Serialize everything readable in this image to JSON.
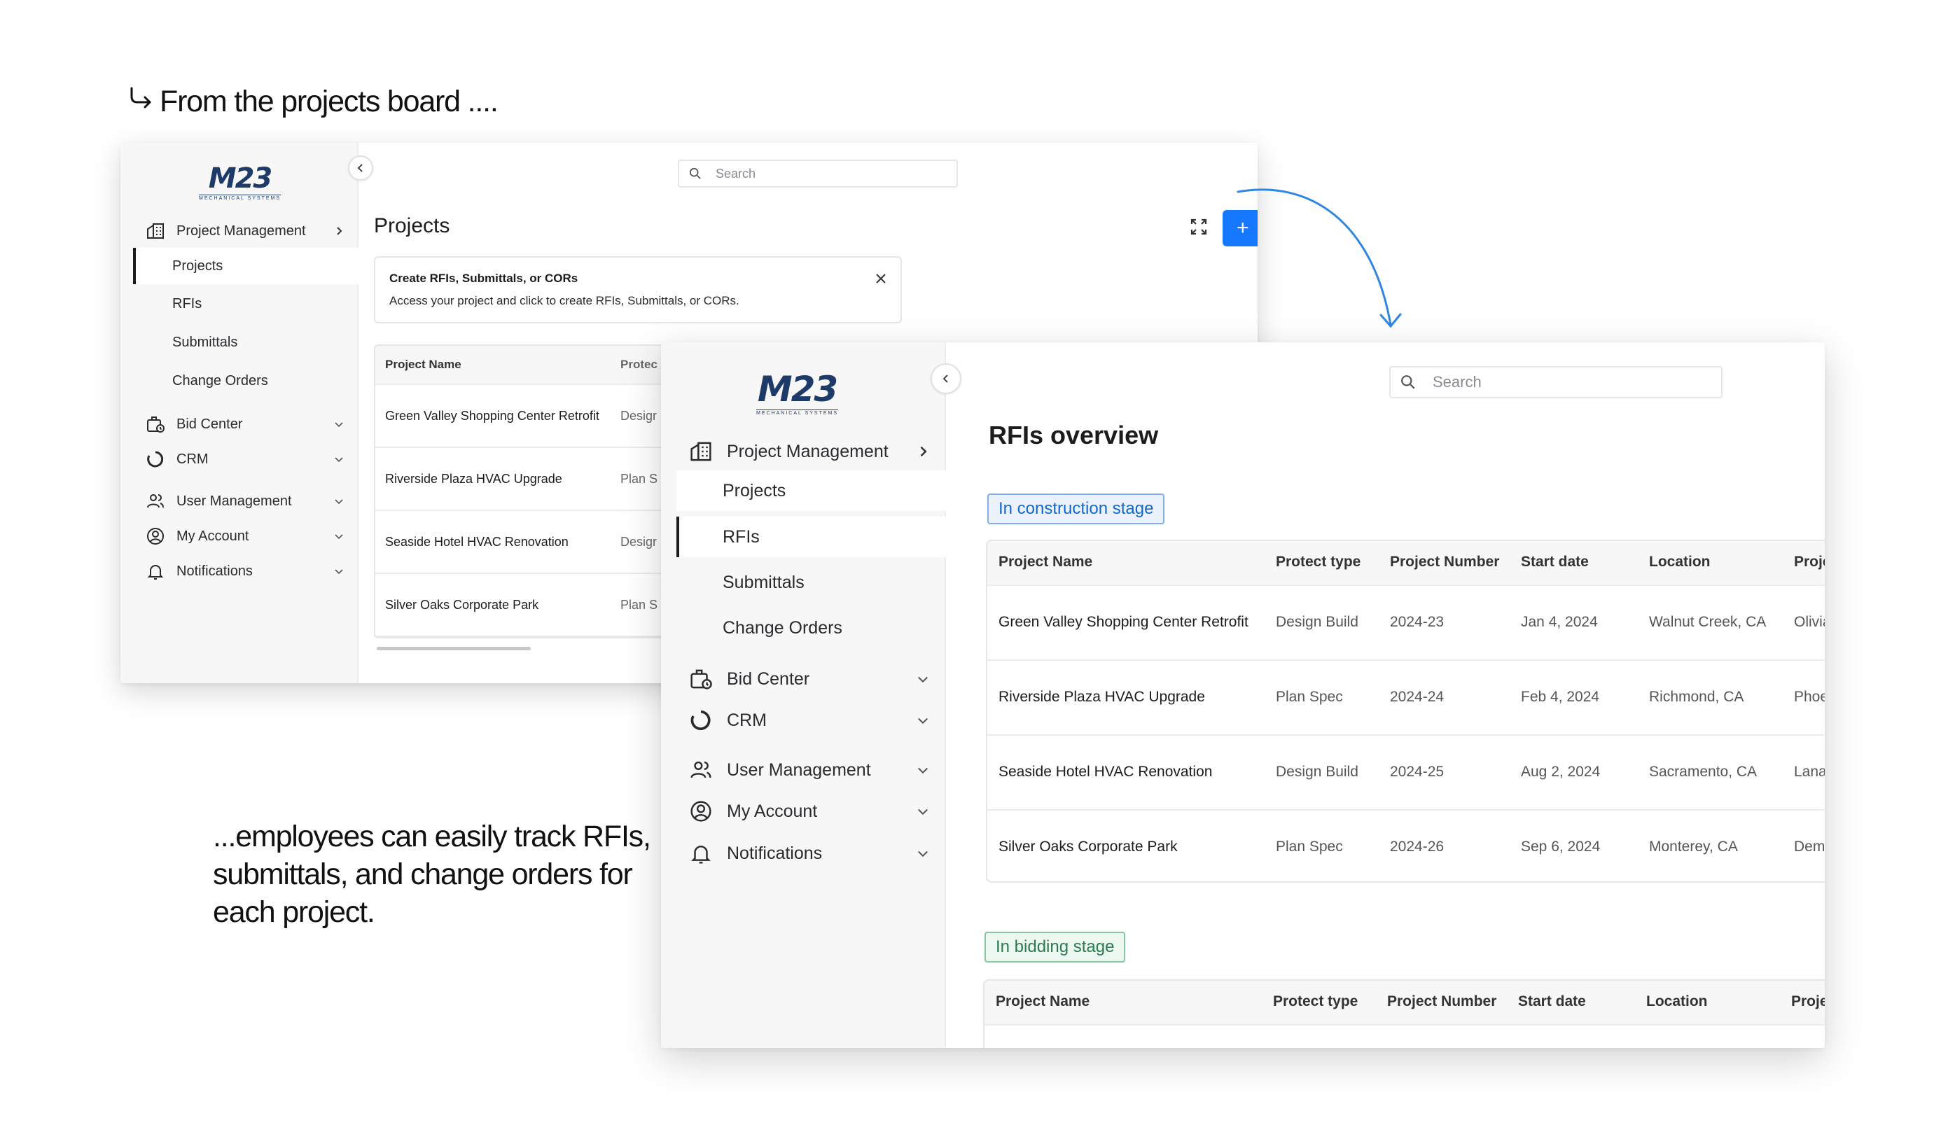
{
  "captions": {
    "top": "From the projects board ....",
    "bottom": "...employees can easily track RFIs, submittals, and change orders for each project."
  },
  "brand": {
    "logo_mark": "M23",
    "logo_sub": "MECHANICAL SYSTEMS",
    "accent": "#1677ff"
  },
  "sidebar": {
    "section": "Project Management",
    "items": [
      "Projects",
      "RFIs",
      "Submittals",
      "Change Orders"
    ],
    "groups": [
      "Bid Center",
      "CRM",
      "User Management",
      "My Account",
      "Notifications"
    ]
  },
  "search": {
    "placeholder": "Search"
  },
  "projects_window": {
    "title": "Projects",
    "add_label": "+",
    "notice": {
      "title": "Create RFIs, Submittals, or CORs",
      "desc": "Access your project and click to create RFIs, Submittals, or CORs."
    },
    "columns": [
      "Project  Name",
      "Protec"
    ],
    "rows": [
      [
        "Green Valley Shopping Center Retrofit",
        "Desigr"
      ],
      [
        "Riverside Plaza HVAC Upgrade",
        "Plan S"
      ],
      [
        "Seaside Hotel HVAC Renovation",
        "Desigr"
      ],
      [
        "Silver Oaks Corporate Park",
        "Plan S"
      ]
    ]
  },
  "rfis_window": {
    "title": "RFIs overview",
    "construction_label": "In construction stage",
    "bidding_label": "In bidding stage",
    "columns": [
      "Project  Name",
      "Protect type",
      "Project Number",
      "Start date",
      "Location",
      "Proje"
    ],
    "bidding_columns": [
      "Project  Name",
      "Protect type",
      "Project Number",
      "Start date",
      "Location",
      "Proje"
    ],
    "rows": [
      [
        "Green Valley Shopping Center Retrofit",
        "Design Build",
        "2024-23",
        "Jan 4, 2024",
        "Walnut Creek, CA",
        "Olivia"
      ],
      [
        "Riverside Plaza HVAC Upgrade",
        "Plan Spec",
        "2024-24",
        "Feb 4, 2024",
        "Richmond, CA",
        "Phoe"
      ],
      [
        "Seaside Hotel HVAC Renovation",
        "Design Build",
        "2024-25",
        "Aug 2, 2024",
        "Sacramento, CA",
        "Lana"
      ],
      [
        "Silver Oaks Corporate Park",
        "Plan Spec",
        "2024-26",
        "Sep 6, 2024",
        "Monterey, CA",
        "Demi"
      ]
    ]
  }
}
